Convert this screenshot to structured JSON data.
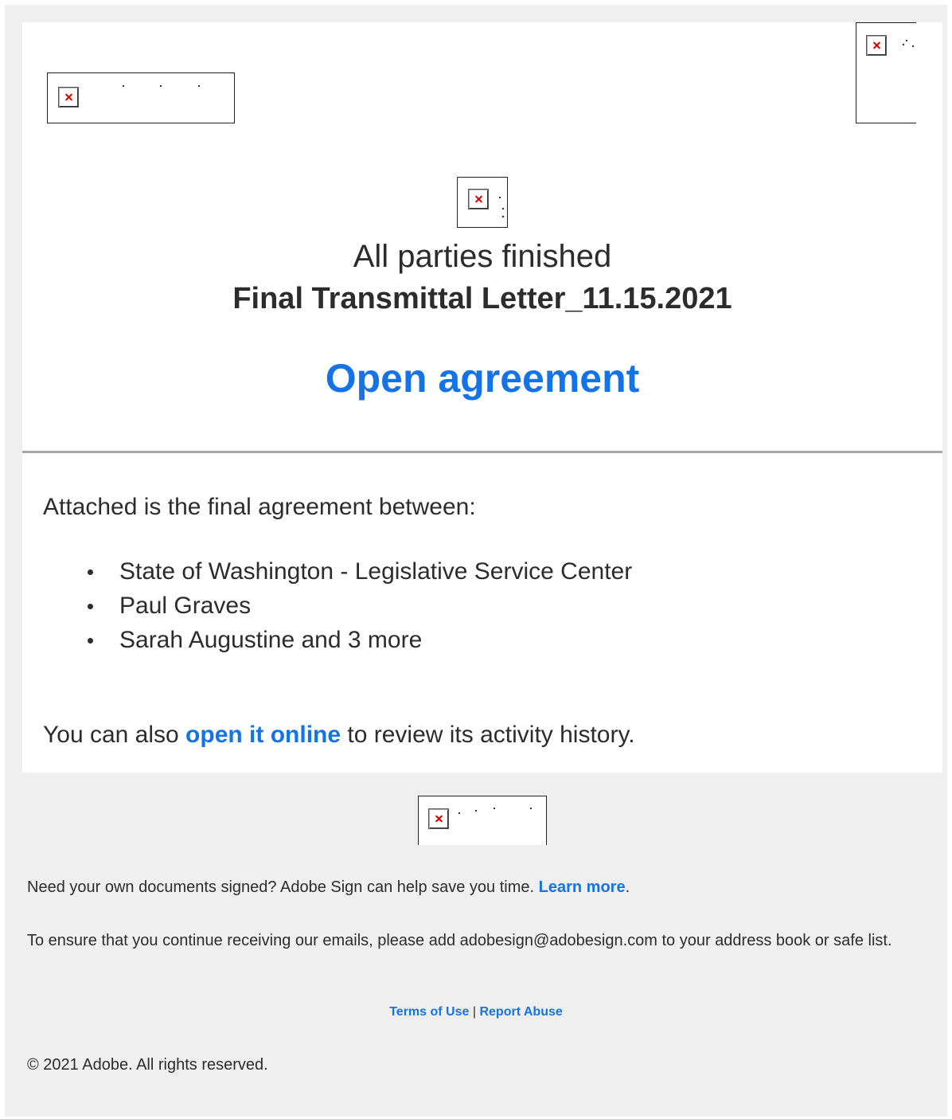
{
  "header": {
    "status": "All parties finished",
    "document_title": "Final Transmittal Letter_11.15.2021",
    "open_agreement_label": "Open agreement"
  },
  "body": {
    "intro": "Attached is the final agreement between:",
    "parties": [
      "State of Washington - Legislative Service Center",
      "Paul Graves",
      "Sarah Augustine and 3 more"
    ],
    "also_prefix": "You can also ",
    "also_link": "open it online",
    "also_suffix": " to review its activity history."
  },
  "footer": {
    "promo_text": "Need your own documents signed? Adobe Sign can help save you time. ",
    "promo_link": "Learn more",
    "promo_end": ".",
    "safelist_text": "To ensure that you continue receiving our emails, please add adobesign@adobesign.com to your address book or safe list.",
    "terms_link": "Terms of Use",
    "separator": "|",
    "report_link": "Report Abuse",
    "copyright": "© 2021 Adobe. All rights reserved."
  },
  "colors": {
    "link_blue": "#1473e6",
    "text": "#2c2c2c",
    "background": "#efefef",
    "divider": "#a7a7a7"
  },
  "icons": {
    "broken_image": "broken-image-icon"
  }
}
